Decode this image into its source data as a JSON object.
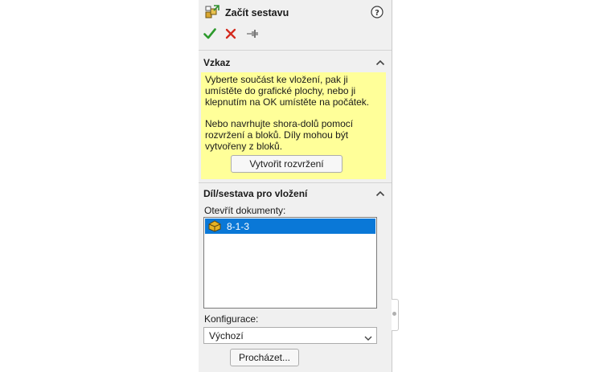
{
  "panel": {
    "title": "Začít sestavu",
    "help_icon": "help-question-icon",
    "actions": {
      "ok_icon": "green-check-icon",
      "cancel_icon": "red-x-icon",
      "pin_icon": "pushpin-icon"
    }
  },
  "message_section": {
    "title": "Vzkaz",
    "paragraph1": "Vyberte součást ke vložení, pak ji umístěte do grafické plochy, nebo ji klepnutím na OK umístěte na počátek.",
    "paragraph2": "Nebo navrhujte shora-dolů pomocí rozvržení a bloků. Díly mohou být vytvořeny z bloků.",
    "create_layout_button": "Vytvořit rozvržení",
    "background_color": "#ffff99"
  },
  "insert_section": {
    "title": "Díl/sestava pro vložení",
    "open_documents_label": "Otevřít dokumenty:",
    "documents": [
      {
        "name": "8-1-3",
        "icon": "part-icon",
        "selected": true
      }
    ],
    "configuration_label": "Konfigurace:",
    "configuration_value": "Výchozí",
    "browse_button": "Procházet..."
  },
  "colors": {
    "selection": "#0a78d7",
    "check": "#2d9a2d",
    "cancel": "#d42a1e"
  }
}
